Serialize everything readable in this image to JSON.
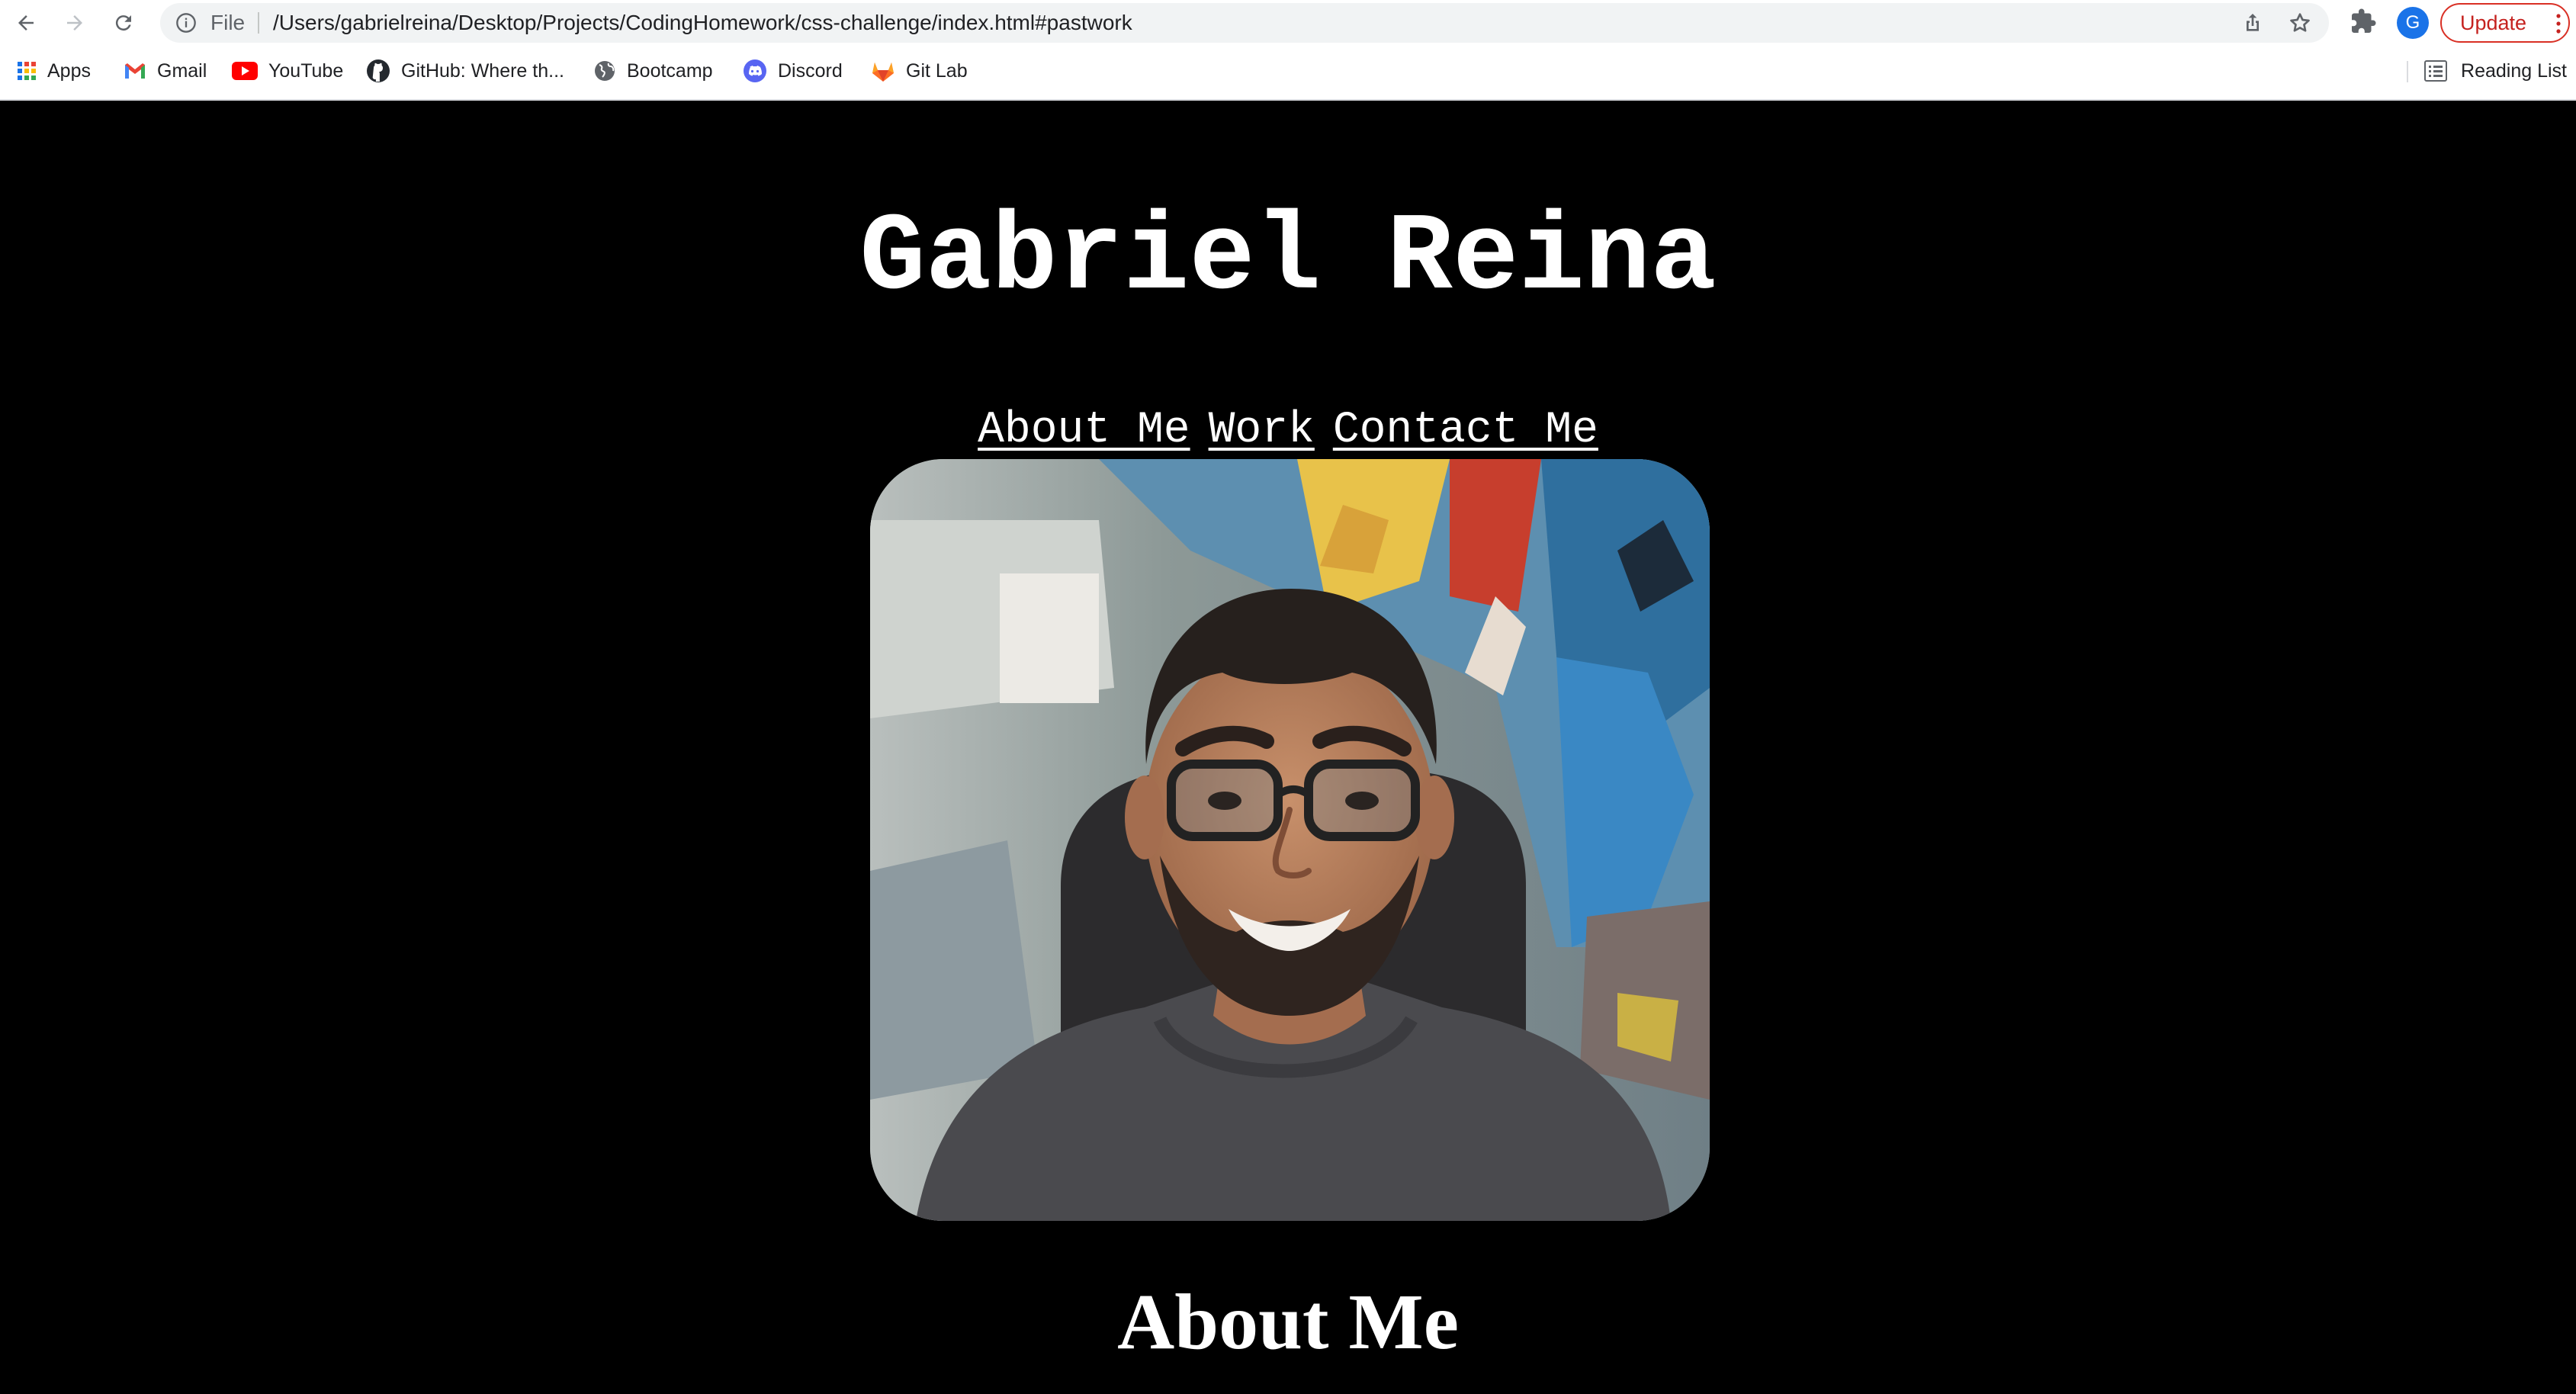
{
  "browser": {
    "omnibox": {
      "scheme_label": "File",
      "url": "/Users/gabrielreina/Desktop/Projects/CodingHomework/css-challenge/index.html#pastwork"
    },
    "profile_initial": "G",
    "update_label": "Update",
    "bookmarks": [
      {
        "label": "Apps",
        "icon": "apps-grid-icon"
      },
      {
        "label": "Gmail",
        "icon": "gmail-icon"
      },
      {
        "label": "YouTube",
        "icon": "youtube-icon"
      },
      {
        "label": "GitHub: Where th...",
        "icon": "github-icon"
      },
      {
        "label": "Bootcamp",
        "icon": "globe-icon"
      },
      {
        "label": "Discord",
        "icon": "discord-icon"
      },
      {
        "label": "Git Lab",
        "icon": "gitlab-icon"
      }
    ],
    "reading_list_label": "Reading List"
  },
  "page": {
    "title": "Gabriel Reina",
    "nav": [
      {
        "label": "About Me"
      },
      {
        "label": "Work"
      },
      {
        "label": "Contact Me"
      }
    ],
    "section_heading": "About Me"
  },
  "colors": {
    "page_background": "#000000",
    "page_text": "#ffffff",
    "update_accent": "#d93025",
    "avatar": "#1a73e8"
  }
}
